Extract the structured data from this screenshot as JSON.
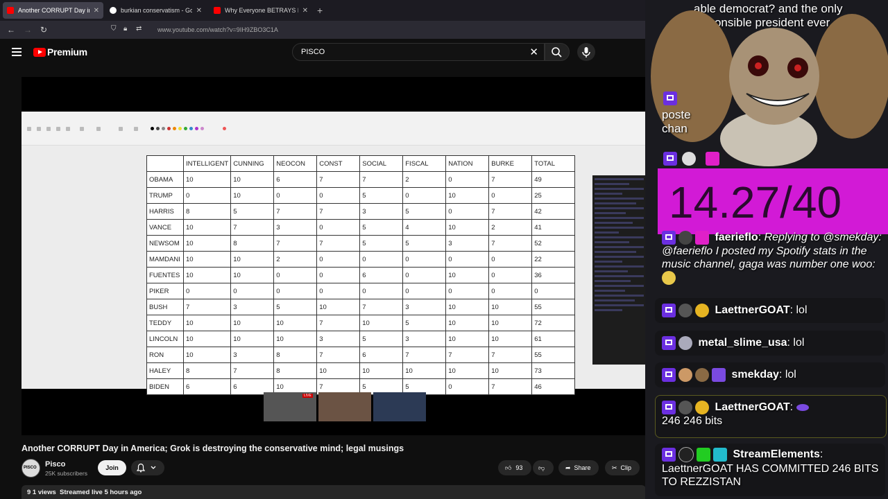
{
  "browser": {
    "tabs": [
      {
        "title": "Another CORRUPT Day in Ameri",
        "active": true,
        "favicon_color": "#ff0000"
      },
      {
        "title": "burkian conservatism - Google",
        "active": false,
        "favicon_color": "#4285f4"
      },
      {
        "title": "Why Everyone BETRAYS Destiny",
        "active": false,
        "favicon_color": "#ff0000"
      }
    ],
    "url": "www.youtube.com/watch?v=9IH9ZBO3C1A"
  },
  "youtube": {
    "brand": "Premium",
    "search_value": "PISCO"
  },
  "table": {
    "headers": [
      "",
      "INTELLIGENT",
      "CUNNING",
      "NEOCON",
      "CONST",
      "SOCIAL",
      "FISCAL",
      "NATION",
      "BURKE",
      "TOTAL"
    ],
    "rows": [
      [
        "OBAMA",
        "10",
        "10",
        "6",
        "7",
        "7",
        "2",
        "0",
        "7",
        "49"
      ],
      [
        "TRUMP",
        "0",
        "10",
        "0",
        "0",
        "5",
        "0",
        "10",
        "0",
        "25"
      ],
      [
        "HARRIS",
        "8",
        "5",
        "7",
        "7",
        "3",
        "5",
        "0",
        "7",
        "42"
      ],
      [
        "VANCE",
        "10",
        "7",
        "3",
        "0",
        "5",
        "4",
        "10",
        "2",
        "41"
      ],
      [
        "NEWSOM",
        "10",
        "8",
        "7",
        "7",
        "5",
        "5",
        "3",
        "7",
        "52"
      ],
      [
        "MAMDANI",
        "10",
        "10",
        "2",
        "0",
        "0",
        "0",
        "0",
        "0",
        "22"
      ],
      [
        "FUENTES",
        "10",
        "10",
        "0",
        "0",
        "6",
        "0",
        "10",
        "0",
        "36"
      ],
      [
        "PIKER",
        "0",
        "0",
        "0",
        "0",
        "0",
        "0",
        "0",
        "0",
        "0"
      ],
      [
        "BUSH",
        "7",
        "3",
        "5",
        "10",
        "7",
        "3",
        "10",
        "10",
        "55"
      ],
      [
        "TEDDY",
        "10",
        "10",
        "10",
        "7",
        "10",
        "5",
        "10",
        "10",
        "72"
      ],
      [
        "LINCOLN",
        "10",
        "10",
        "10",
        "3",
        "5",
        "3",
        "10",
        "10",
        "61"
      ],
      [
        "RON",
        "10",
        "3",
        "8",
        "7",
        "6",
        "7",
        "7",
        "7",
        "55"
      ],
      [
        "HALEY",
        "8",
        "7",
        "8",
        "10",
        "10",
        "10",
        "10",
        "10",
        "73"
      ],
      [
        "BIDEN",
        "6",
        "6",
        "10",
        "7",
        "5",
        "5",
        "0",
        "7",
        "46"
      ]
    ]
  },
  "thumb_live": "LIVE",
  "video": {
    "title": "Another CORRUPT Day in America; Grok is destroying the conservative mind; legal musings",
    "channel": "Pisco",
    "subscribers": "25K subscribers",
    "avatar_text": "PISCO",
    "join": "Join",
    "likes": "93",
    "share": "Share",
    "clip": "Clip",
    "views_prefix": "9 1",
    "views_suffix": "views",
    "streamed": "Streamed live 5 hours ago"
  },
  "overlay": {
    "top_line1": "able democrat? and the only",
    "top_line2": "sponsible president ever",
    "poste": "poste",
    "chan": "chan",
    "progress": "14.27/40",
    "progress_color": "#d21ad6",
    "chat": [
      {
        "user": "faerieflo",
        "text": "Replying to @smekday: @faerieflo I posted my Spotify stats in the music channel, gaga was number one woo:"
      },
      {
        "user": "LaettnerGOAT",
        "text": "lol"
      },
      {
        "user": "metal_slime_usa",
        "text": "lol"
      },
      {
        "user": "smekday",
        "text": "lol"
      },
      {
        "user": "LaettnerGOAT",
        "text": "246 246 bits"
      },
      {
        "user": "StreamElements",
        "text": "LaettnerGOAT HAS COMMITTED 246 BITS TO REZZISTAN"
      }
    ]
  }
}
